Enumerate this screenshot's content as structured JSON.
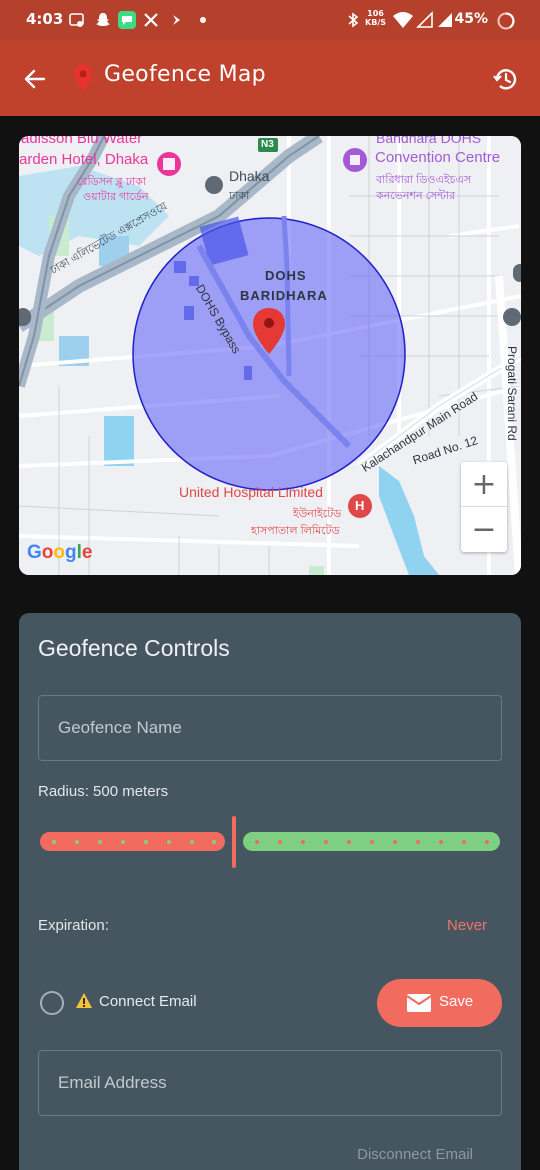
{
  "status_bar": {
    "time": "4:03",
    "net_speed_value": "106",
    "net_speed_unit": "KB/S",
    "battery_percent": "45%"
  },
  "app_bar": {
    "title": "Geofence Map"
  },
  "map": {
    "labels": {
      "hotel_en_1": "adisson Blu Water",
      "hotel_en_2": "arden Hotel, Dhaka",
      "hotel_bn_1": "রেডিসন ব্লু ঢাকা",
      "hotel_bn_2": "ওয়াটার গার্ডেন",
      "route_badge": "N3",
      "dhaka_en": "Dhaka",
      "dhaka_bn": "ঢাকা",
      "convention_top": "Bandhara DOHS",
      "convention_en": "Convention Centre",
      "convention_bn_1": "বারিধারা ডিওএইচএস",
      "convention_bn_2": "কনভেনশন সেন্টার",
      "expressway_bn": "ঢাকা এলিভেটেড এক্সপ্রেসওয়ে",
      "dohs_1": "DOHS",
      "dohs_2": "BARIDHARA",
      "bypass": "DOHS Bypass",
      "main_road": "Kalachandpur Main Road",
      "road12": "Road No. 12",
      "progati": "Progati Sarani Rd",
      "hospital_en": "United Hospital Limited",
      "hospital_bn_1": "ইউনাইটেড",
      "hospital_bn_2": "হাসপাতাল লিমিটেড",
      "hospital_marker": "H",
      "google": "Google"
    },
    "zoom_in": "+",
    "zoom_out": "−",
    "geofence_color": "#5b5bf5",
    "marker_color": "#e53935"
  },
  "controls": {
    "heading": "Geofence Controls",
    "name_placeholder": "Geofence Name",
    "radius_label": "Radius: 500 meters",
    "radius_slider_fraction": 0.42,
    "expiration_label": "Expiration:",
    "expiration_value": "Never",
    "connect_email_label": "Connect Email",
    "save_label": "Save",
    "email_placeholder": "Email Address",
    "disconnect_label": "Disconnect Email"
  },
  "colors": {
    "app_bar": "#c0422d",
    "card": "#455660",
    "accent": "#f26b5f",
    "slider_right": "#7fcf83"
  }
}
